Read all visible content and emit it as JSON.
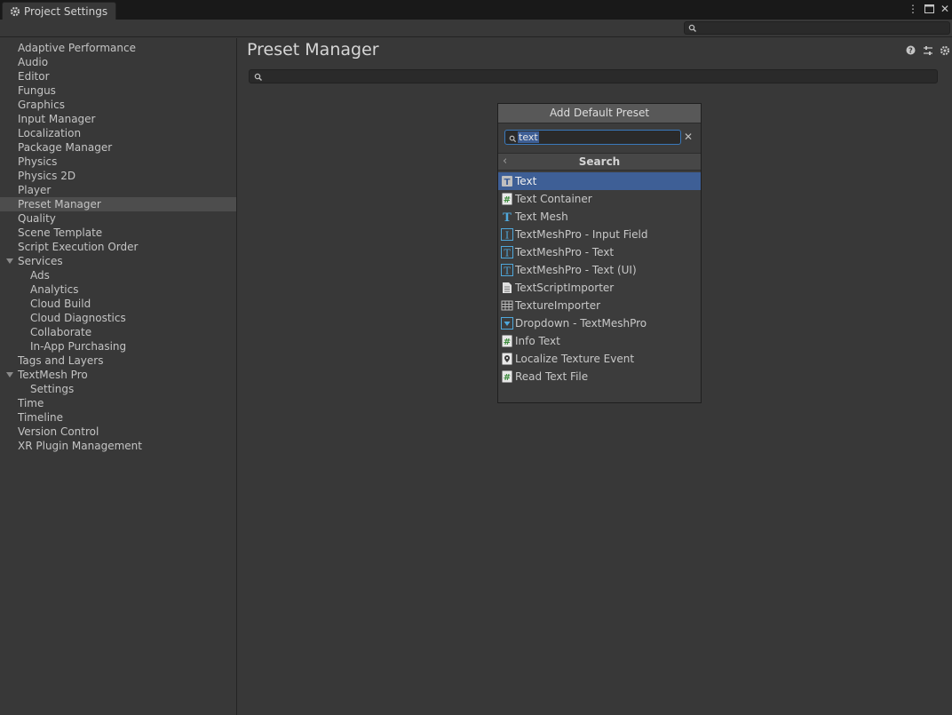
{
  "window": {
    "tab_title": "Project Settings",
    "tab_icon": "gear-icon",
    "controls": [
      "kebab-menu-icon",
      "maximize-icon",
      "close-icon"
    ]
  },
  "toolbar": {
    "search_value": ""
  },
  "sidebar": {
    "items": [
      {
        "label": "Adaptive Performance",
        "level": 0
      },
      {
        "label": "Audio",
        "level": 0
      },
      {
        "label": "Editor",
        "level": 0
      },
      {
        "label": "Fungus",
        "level": 0
      },
      {
        "label": "Graphics",
        "level": 0
      },
      {
        "label": "Input Manager",
        "level": 0
      },
      {
        "label": "Localization",
        "level": 0
      },
      {
        "label": "Package Manager",
        "level": 0
      },
      {
        "label": "Physics",
        "level": 0
      },
      {
        "label": "Physics 2D",
        "level": 0
      },
      {
        "label": "Player",
        "level": 0
      },
      {
        "label": "Preset Manager",
        "level": 0,
        "selected": true
      },
      {
        "label": "Quality",
        "level": 0
      },
      {
        "label": "Scene Template",
        "level": 0
      },
      {
        "label": "Script Execution Order",
        "level": 0
      },
      {
        "label": "Services",
        "level": 0,
        "expanded": true
      },
      {
        "label": "Ads",
        "level": 1
      },
      {
        "label": "Analytics",
        "level": 1
      },
      {
        "label": "Cloud Build",
        "level": 1
      },
      {
        "label": "Cloud Diagnostics",
        "level": 1
      },
      {
        "label": "Collaborate",
        "level": 1
      },
      {
        "label": "In-App Purchasing",
        "level": 1
      },
      {
        "label": "Tags and Layers",
        "level": 0
      },
      {
        "label": "TextMesh Pro",
        "level": 0,
        "expanded": true
      },
      {
        "label": "Settings",
        "level": 1
      },
      {
        "label": "Time",
        "level": 0
      },
      {
        "label": "Timeline",
        "level": 0
      },
      {
        "label": "Version Control",
        "level": 0
      },
      {
        "label": "XR Plugin Management",
        "level": 0
      }
    ]
  },
  "main": {
    "title": "Preset Manager",
    "header_icons": [
      "help-icon",
      "presets-icon",
      "settings-gear-icon"
    ],
    "search_value": ""
  },
  "popup": {
    "button_label": "Add Default Preset",
    "search_value": "text",
    "header_title": "Search",
    "results": [
      {
        "label": "Text",
        "icon": "text-icon",
        "selected": true
      },
      {
        "label": "Text Container",
        "icon": "script-hash-icon"
      },
      {
        "label": "Text Mesh",
        "icon": "text-mesh-icon"
      },
      {
        "label": "TextMeshPro - Input Field",
        "icon": "tmp-input-field-icon"
      },
      {
        "label": "TextMeshPro - Text",
        "icon": "tmp-text-icon"
      },
      {
        "label": "TextMeshPro - Text (UI)",
        "icon": "tmp-text-ui-icon"
      },
      {
        "label": "TextScriptImporter",
        "icon": "document-icon"
      },
      {
        "label": "TextureImporter",
        "icon": "texture-grid-icon"
      },
      {
        "label": "Dropdown - TextMeshPro",
        "icon": "dropdown-icon"
      },
      {
        "label": "Info Text",
        "icon": "script-hash-icon"
      },
      {
        "label": "Localize Texture Event",
        "icon": "location-pin-icon"
      },
      {
        "label": "Read Text File",
        "icon": "script-hash-icon"
      }
    ]
  },
  "colors": {
    "background": "#383838",
    "titlebar": "#191919",
    "selection": "#3e5f96",
    "sidebar_selection": "#4d4d4d",
    "accent_icon": "#4fa8dc"
  }
}
